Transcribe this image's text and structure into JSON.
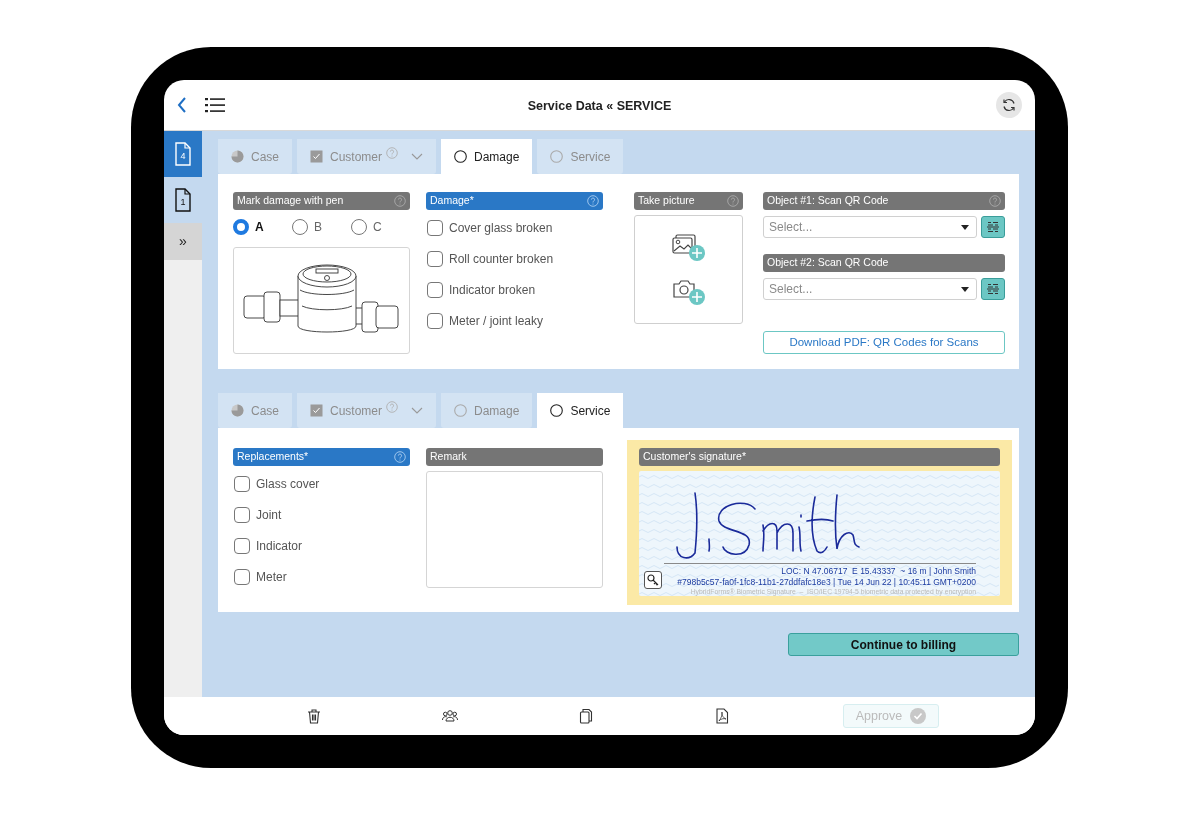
{
  "header": {
    "title": "Service Data « SERVICE"
  },
  "sidebar": {
    "items": [
      {
        "label": "4",
        "selected": true
      },
      {
        "label": "1",
        "selected": false
      }
    ],
    "expand_label": "»"
  },
  "damage_section": {
    "tabs": [
      {
        "label": "Case",
        "kind": "partial",
        "selected": false,
        "help": false,
        "dropdown": false
      },
      {
        "label": "Customer",
        "kind": "checked",
        "selected": false,
        "help": true,
        "dropdown": true
      },
      {
        "label": "Damage",
        "kind": "empty",
        "selected": true,
        "help": false,
        "dropdown": false
      },
      {
        "label": "Service",
        "kind": "empty",
        "selected": false,
        "help": false,
        "dropdown": false
      }
    ],
    "mark_damage": {
      "label": "Mark damage with pen",
      "highlighted": false,
      "help": true,
      "options": [
        {
          "label": "A",
          "selected": true
        },
        {
          "label": "B",
          "selected": false
        },
        {
          "label": "C",
          "selected": false
        }
      ]
    },
    "damage": {
      "label": "Damage*",
      "highlighted": true,
      "help": true,
      "options": [
        {
          "label": "Cover glass broken",
          "checked": false
        },
        {
          "label": "Roll counter broken",
          "checked": false
        },
        {
          "label": "Indicator broken",
          "checked": false
        },
        {
          "label": "Meter / joint leaky",
          "checked": false
        }
      ]
    },
    "take_picture": {
      "label": "Take picture",
      "highlighted": false,
      "help": true
    },
    "objects": [
      {
        "label": "Object #1: Scan QR Code",
        "highlighted": false,
        "help": true,
        "placeholder": "Select..."
      },
      {
        "label": "Object #2: Scan QR Code",
        "highlighted": false,
        "help": false,
        "placeholder": "Select..."
      }
    ],
    "download_button": "Download PDF: QR Codes for Scans"
  },
  "service_section": {
    "tabs": [
      {
        "label": "Case",
        "kind": "partial",
        "selected": false,
        "help": false,
        "dropdown": false
      },
      {
        "label": "Customer",
        "kind": "checked",
        "selected": false,
        "help": true,
        "dropdown": true
      },
      {
        "label": "Damage",
        "kind": "empty",
        "selected": false,
        "help": false,
        "dropdown": false
      },
      {
        "label": "Service",
        "kind": "empty",
        "selected": true,
        "help": false,
        "dropdown": false
      }
    ],
    "replacements": {
      "label": "Replacements*",
      "highlighted": true,
      "help": true,
      "options": [
        {
          "label": "Glass cover",
          "checked": false
        },
        {
          "label": "Joint",
          "checked": false
        },
        {
          "label": "Indicator",
          "checked": false
        },
        {
          "label": "Meter",
          "checked": false
        }
      ]
    },
    "remark": {
      "label": "Remark",
      "highlighted": false,
      "help": false
    },
    "signature": {
      "label": "Customer's signature*",
      "highlighted": false,
      "help": false,
      "location": "LOC: N 47.06717  E 15.43337  ~ 16 m | John Smith",
      "hash": "#798b5c57-fa0f-1fc8-11b1-27ddfafc18e3 | Tue 14 Jun 22 | 10:45:11 GMT+0200",
      "notice": "HybridForms® Biometric Signature  –  ISO/IEC 19794-5 biometric data protected by encryption"
    }
  },
  "continue_button": "Continue to billing",
  "toolbar": {
    "approve": {
      "label": "Approve",
      "disabled": true
    }
  }
}
